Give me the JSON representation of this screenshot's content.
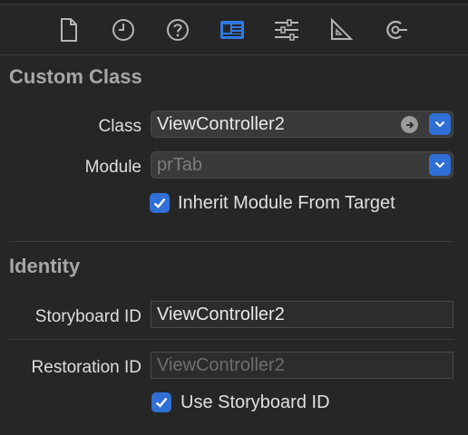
{
  "toolbar": {
    "icons": [
      "file-icon",
      "history-icon",
      "help-icon",
      "identity-icon",
      "attributes-icon",
      "size-icon",
      "connections-icon"
    ]
  },
  "custom_class": {
    "title": "Custom Class",
    "class_label": "Class",
    "class_value": "ViewController2",
    "module_label": "Module",
    "module_placeholder": "prTab",
    "inherit_label": "Inherit Module From Target",
    "inherit_checked": true
  },
  "identity": {
    "title": "Identity",
    "storyboard_label": "Storyboard ID",
    "storyboard_value": "ViewController2",
    "restoration_label": "Restoration ID",
    "restoration_placeholder": "ViewController2",
    "use_storyboard_label": "Use Storyboard ID",
    "use_storyboard_checked": true
  },
  "colors": {
    "background": "#262626",
    "accent": "#2f6fd6"
  }
}
